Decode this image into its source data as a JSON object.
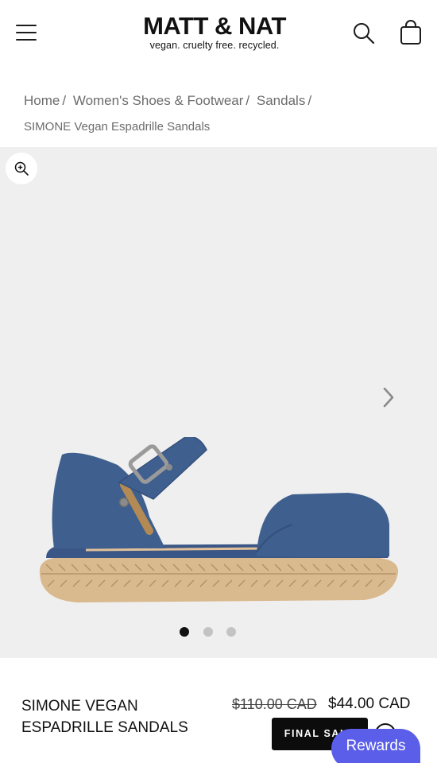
{
  "header": {
    "brand": "MATT & NAT",
    "tagline": "vegan. cruelty free. recycled.",
    "menu_icon": "hamburger-menu-icon",
    "search_icon": "search-icon",
    "cart_icon": "shopping-bag-icon"
  },
  "breadcrumb": {
    "items": [
      {
        "label": "Home"
      },
      {
        "label": "Women's Shoes & Footwear"
      },
      {
        "label": "Sandals"
      }
    ],
    "separator": "/",
    "current": "SIMONE Vegan Espadrille Sandals"
  },
  "gallery": {
    "zoom_icon": "zoom-in-icon",
    "next_icon": "chevron-right-icon",
    "slide_count": 3,
    "active_slide": 1,
    "colors": {
      "background": "#efefef",
      "shoe": "#3f5f8f",
      "sole": "#d9b98e"
    }
  },
  "product": {
    "title": "SIMONE VEGAN ESPADRILLE SANDALS",
    "price_original": "$110.00 CAD",
    "price_sale": "$44.00 CAD",
    "badge": "FINAL SALE",
    "info_icon": "info-icon"
  },
  "rewards": {
    "label": "Rewards",
    "color": "#5b5ee8"
  }
}
